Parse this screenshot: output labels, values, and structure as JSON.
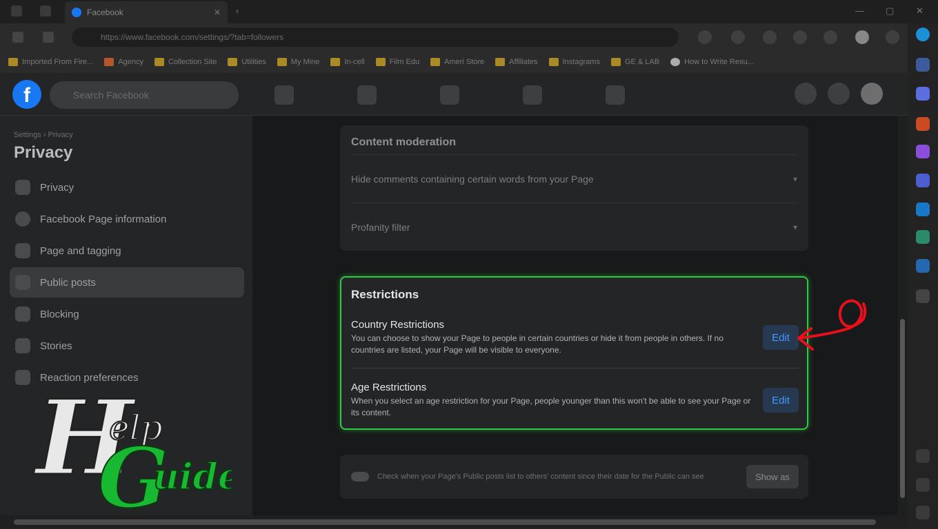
{
  "browser": {
    "tab_title": "Facebook",
    "url": "https://www.facebook.com/settings/?tab=followers",
    "bookmarks": [
      "Imported From Fire...",
      "Agency",
      "Collection Site",
      "Utilities",
      "My Mine",
      "In-cell",
      "Film Edu",
      "Ameri Store",
      "Affiliates",
      "Instagrams",
      "GE & LAB",
      "How to Write Resu..."
    ]
  },
  "facebook": {
    "logo_letter": "f",
    "search_placeholder": "Search Facebook"
  },
  "sidebar": {
    "breadcrumb": "Settings › Privacy",
    "title": "Privacy",
    "items": [
      {
        "label": "Privacy",
        "icon": "lock-icon"
      },
      {
        "label": "Facebook Page information",
        "icon": "info-icon"
      },
      {
        "label": "Page and tagging",
        "icon": "tag-icon"
      },
      {
        "label": "Public posts",
        "icon": "posts-icon"
      },
      {
        "label": "Blocking",
        "icon": "block-icon"
      },
      {
        "label": "Stories",
        "icon": "stories-icon"
      },
      {
        "label": "Reaction preferences",
        "icon": "reaction-icon"
      }
    ]
  },
  "content_moderation": {
    "heading": "Content moderation",
    "rows": [
      "Hide comments containing certain words from your Page",
      "Profanity filter"
    ]
  },
  "restrictions": {
    "title": "Restrictions",
    "country": {
      "title": "Country Restrictions",
      "description": "You can choose to show your Page to people in certain countries or hide it from people in others. If no countries are listed, your Page will be visible to everyone.",
      "button": "Edit"
    },
    "age": {
      "title": "Age Restrictions",
      "description": "When you select an age restriction for your Page, people younger than this won't be able to see your Page or its content.",
      "button": "Edit"
    }
  },
  "bottom_card": {
    "text": "Check when your Page's Public posts list to others' content since their date for the Public can see",
    "button": "Show as"
  },
  "watermark": {
    "letter_h": "H",
    "word_elp": "elp",
    "letter_g": "G",
    "word_uider": "uider"
  },
  "colors": {
    "highlight": "#2ecc40",
    "annotation_arrow": "#e8101c",
    "edit_text": "#4599ff"
  }
}
